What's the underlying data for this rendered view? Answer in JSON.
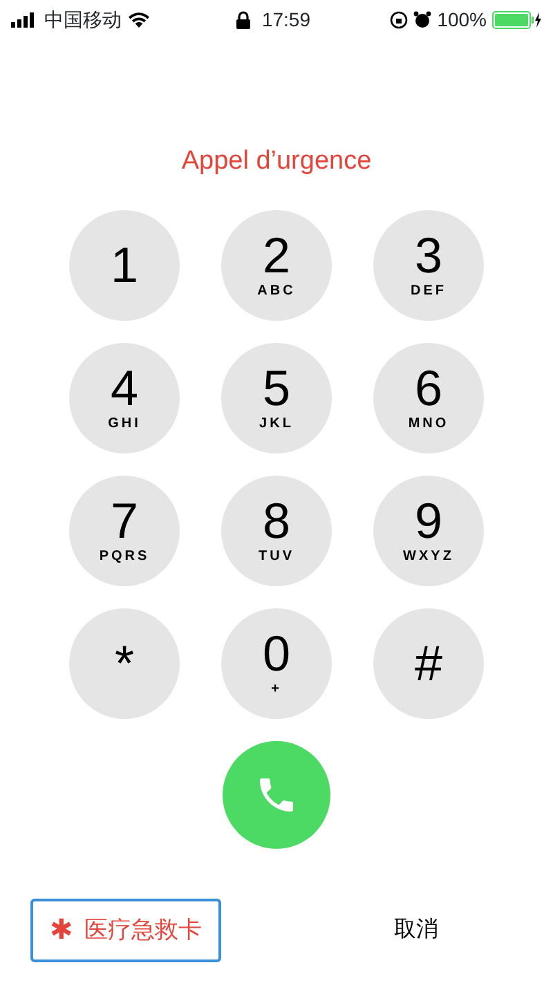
{
  "status_bar": {
    "carrier": "中国移动",
    "time": "17:59",
    "battery": "100%"
  },
  "title": "Appel d’urgence",
  "keys": [
    {
      "digit": "1"
    },
    {
      "digit": "2",
      "letters": "ABC"
    },
    {
      "digit": "3",
      "letters": "DEF"
    },
    {
      "digit": "4",
      "letters": "GHI"
    },
    {
      "digit": "5",
      "letters": "JKL"
    },
    {
      "digit": "6",
      "letters": "MNO"
    },
    {
      "digit": "7",
      "letters": "PQRS"
    },
    {
      "digit": "8",
      "letters": "TUV"
    },
    {
      "digit": "9",
      "letters": "WXYZ"
    },
    {
      "digit": "*"
    },
    {
      "digit": "0",
      "letters": "+"
    },
    {
      "digit": "#"
    }
  ],
  "medical_id_button": {
    "icon": "✱",
    "label": "医疗急救卡"
  },
  "cancel_button": "取消"
}
